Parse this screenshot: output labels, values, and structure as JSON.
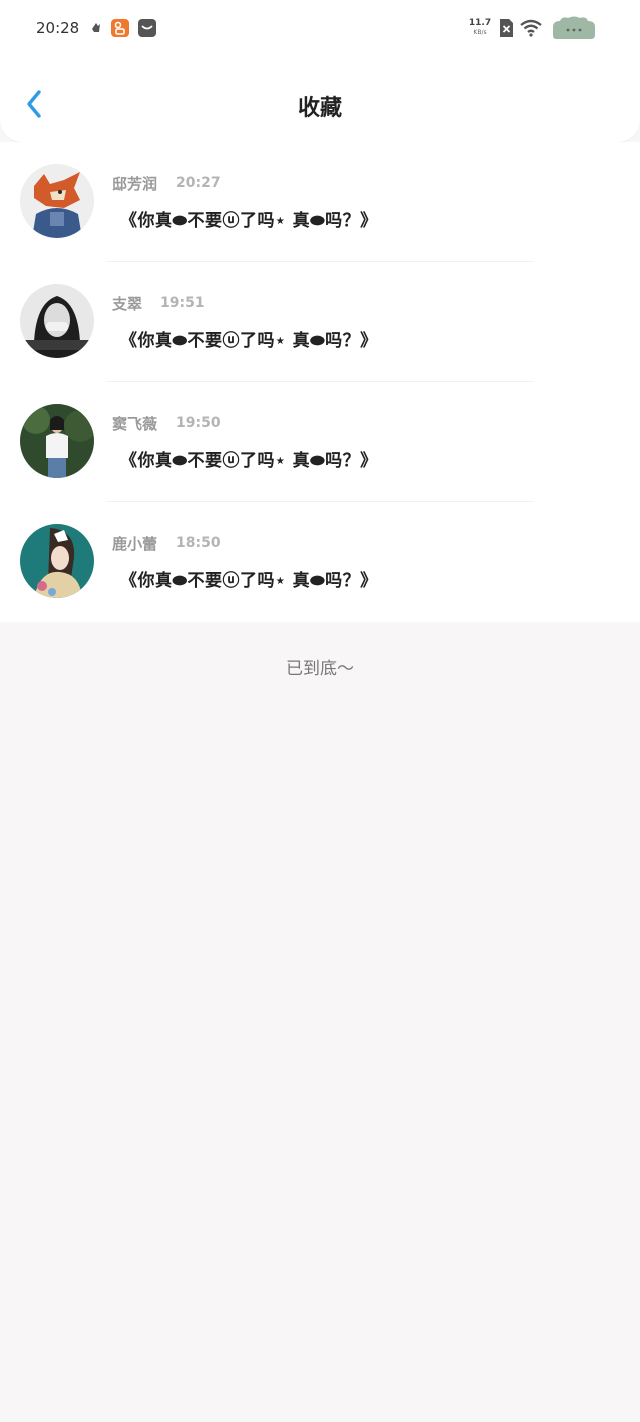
{
  "status_bar": {
    "time": "20:28",
    "net_speed_value": "11.7",
    "net_speed_unit": "KB/s"
  },
  "header": {
    "title": "收藏",
    "back_icon": "chevron-left-icon"
  },
  "favorites": [
    {
      "name": "邸芳润",
      "time": "20:27",
      "message": "《你真⬬不要ⓤ了吗⋆ 真⬬吗？》"
    },
    {
      "name": "支翠",
      "time": "19:51",
      "message": "《你真⬬不要ⓤ了吗⋆ 真⬬吗？》"
    },
    {
      "name": "窦飞薇",
      "time": "19:50",
      "message": "《你真⬬不要ⓤ了吗⋆ 真⬬吗？》"
    },
    {
      "name": "鹿小蕾",
      "time": "18:50",
      "message": "《你真⬬不要ⓤ了吗⋆ 真⬬吗？》"
    }
  ],
  "footer": {
    "end_text": "已到底～"
  },
  "colors": {
    "accent": "#2f9be8",
    "background": "#f8f6f7"
  }
}
